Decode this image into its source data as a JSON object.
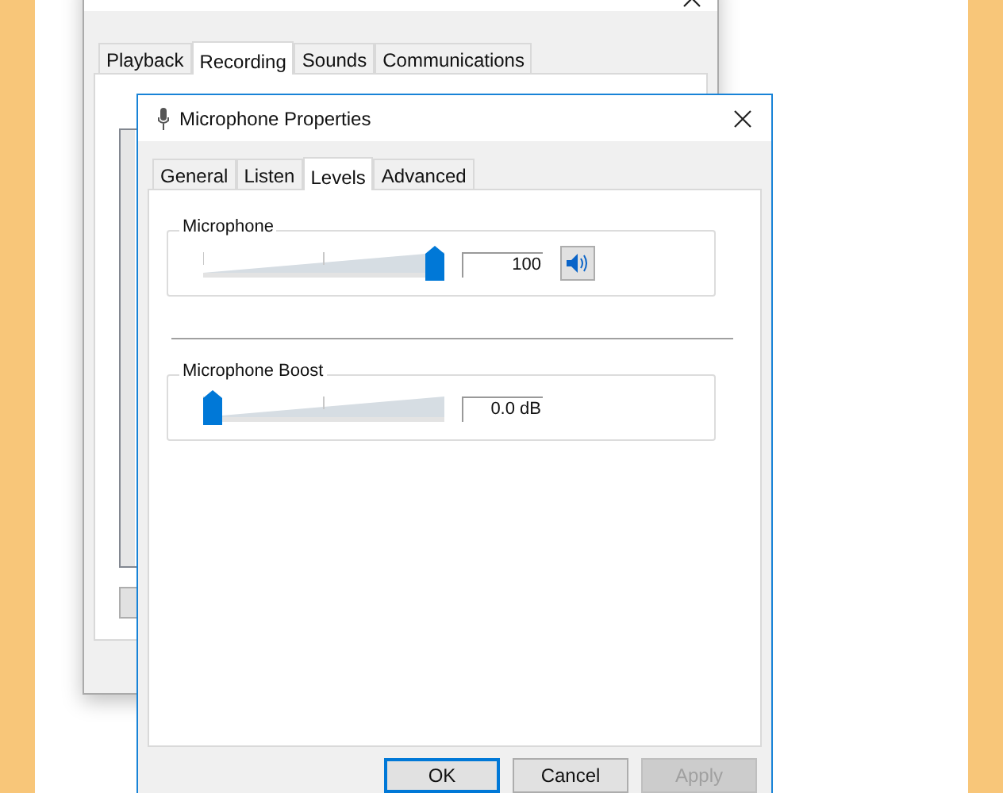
{
  "back_window": {
    "tabs": [
      {
        "label": "Playback",
        "selected": false
      },
      {
        "label": "Recording",
        "selected": true
      },
      {
        "label": "Sounds",
        "selected": false
      },
      {
        "label": "Communications",
        "selected": false
      }
    ]
  },
  "dialog": {
    "title": "Microphone Properties",
    "tabs": [
      {
        "label": "General",
        "selected": false
      },
      {
        "label": "Listen",
        "selected": false
      },
      {
        "label": "Levels",
        "selected": true
      },
      {
        "label": "Advanced",
        "selected": false
      }
    ],
    "groups": [
      {
        "label": "Microphone",
        "level": 1,
        "reading": "100",
        "mute_button": true
      },
      {
        "label": "Microphone Boost",
        "level": 0,
        "reading": "0.0 dB",
        "mute_button": false
      }
    ],
    "buttons": [
      {
        "label": "OK",
        "focused": true,
        "disabled": false
      },
      {
        "label": "Cancel",
        "focused": false,
        "disabled": false
      },
      {
        "label": "Apply",
        "focused": false,
        "disabled": true
      }
    ]
  }
}
